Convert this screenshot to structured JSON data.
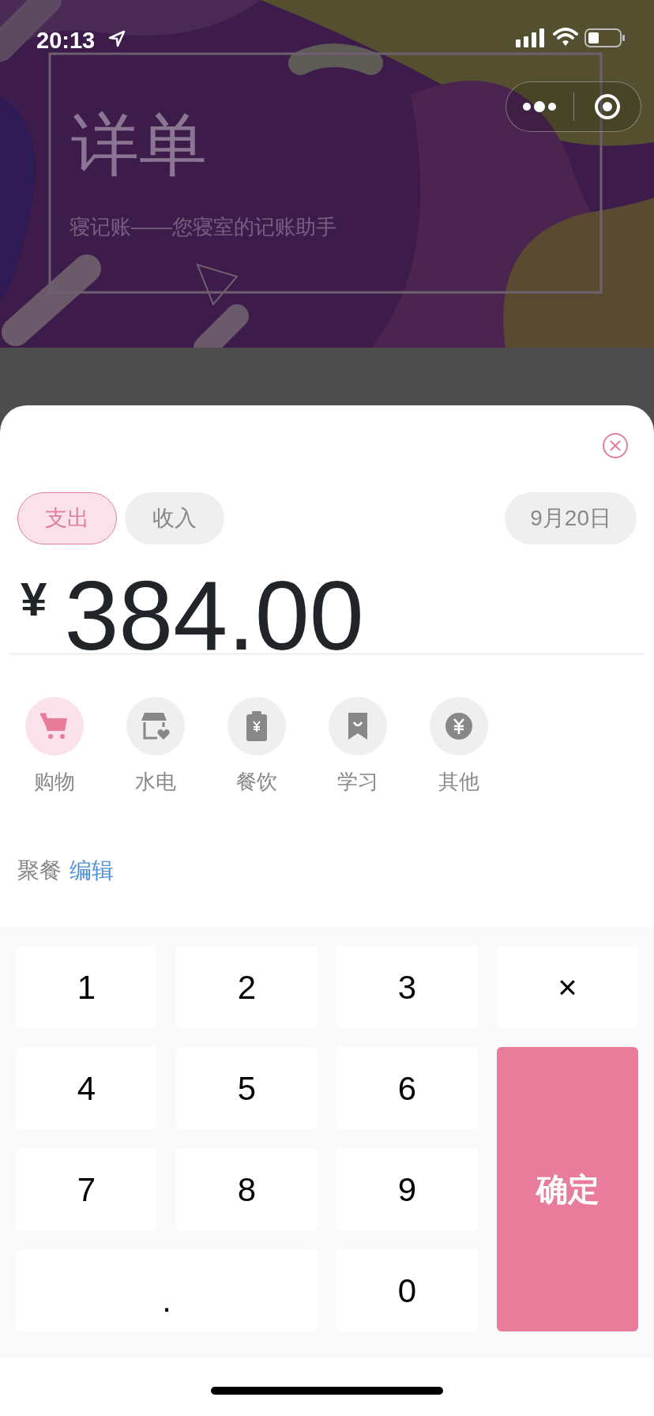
{
  "status_bar": {
    "time": "20:13"
  },
  "header": {
    "title": "详单",
    "subtitle": "寝记账——您寝室的记账助手"
  },
  "sheet": {
    "type_tabs": [
      {
        "label": "支出",
        "selected": true
      },
      {
        "label": "收入",
        "selected": false
      }
    ],
    "date": "9月20日",
    "amount": {
      "currency": "¥",
      "value": "384.00"
    },
    "categories": [
      {
        "label": "购物",
        "kind": "cart",
        "selected": true
      },
      {
        "label": "水电",
        "kind": "shop",
        "selected": false
      },
      {
        "label": "餐饮",
        "kind": "receipt",
        "selected": false
      },
      {
        "label": "学习",
        "kind": "bookmark",
        "selected": false
      },
      {
        "label": "其他",
        "kind": "coin",
        "selected": false
      }
    ],
    "note": {
      "text": "聚餐",
      "link": "编辑"
    },
    "keypad": [
      {
        "label": "1",
        "kind": "digit"
      },
      {
        "label": "2",
        "kind": "digit"
      },
      {
        "label": "3",
        "kind": "digit"
      },
      {
        "label": "×",
        "kind": "delete"
      },
      {
        "label": "4",
        "kind": "digit"
      },
      {
        "label": "5",
        "kind": "digit"
      },
      {
        "label": "6",
        "kind": "digit"
      },
      {
        "label": "7",
        "kind": "digit"
      },
      {
        "label": "8",
        "kind": "digit"
      },
      {
        "label": "9",
        "kind": "digit"
      },
      {
        "label": "确定",
        "kind": "confirm"
      },
      {
        "label": ".",
        "kind": "dot"
      },
      {
        "label": "0",
        "kind": "digit"
      }
    ]
  }
}
